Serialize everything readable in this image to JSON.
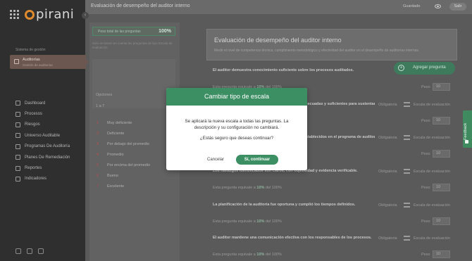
{
  "app": {
    "logo_text": "pirani"
  },
  "header": {
    "title": "Evaluación de desempeño del auditor interno",
    "status": "Guardado",
    "exit_label": "Salir"
  },
  "sidebar": {
    "caption": "Sistema de gestión",
    "active_item": {
      "label": "Auditorías",
      "sublabel": "Gestión de auditorías"
    },
    "items": [
      {
        "label": "Dashboard",
        "icon": "monitor-icon"
      },
      {
        "label": "Procesos",
        "icon": "list-icon"
      },
      {
        "label": "Riesgos",
        "icon": "alert-icon"
      },
      {
        "label": "Universo Auditable",
        "icon": "grid-icon"
      },
      {
        "label": "Programas De Auditoría",
        "icon": "folder-icon"
      },
      {
        "label": "Planes De Remediación",
        "icon": "check-icon"
      },
      {
        "label": "Reportes",
        "icon": "doc-icon"
      },
      {
        "label": "Indicadores",
        "icon": "target-icon"
      }
    ]
  },
  "left_panel": {
    "total_label": "Peso total de las preguntas",
    "total_value": "100%",
    "note": "Solo se tienen en cuenta las preguntas de tipo Escala de evaluación",
    "options_label": "Opciones",
    "range": "1 a 7",
    "scale": [
      {
        "num": "1",
        "label": "Muy deficiente"
      },
      {
        "num": "2",
        "label": "Deficiente"
      },
      {
        "num": "3",
        "label": "Por debajo del promedio"
      },
      {
        "num": "4",
        "label": "Promedio"
      },
      {
        "num": "5",
        "label": "Por encima del promedio"
      },
      {
        "num": "6",
        "label": "Bueno"
      },
      {
        "num": "7",
        "label": "Excelente"
      }
    ]
  },
  "main": {
    "title": "Evaluación de desempeño del auditor interno",
    "description": "Medir el nivel de competencia técnica, cumplimiento metodológico y efectividad del auditor en el desempeño de auditorías internas.",
    "add_button": "Agregar pregunta",
    "required_label": "Obligatoria",
    "scale_label": "Escala de evaluación",
    "weight_label": "Peso",
    "equiv_prefix": "Esta pregunta equivale a",
    "equiv_mid": "del",
    "equiv_total": "100%",
    "questions": [
      {
        "text": "El auditor demuestra conocimiento suficiente sobre los procesos auditados.",
        "equiv": "10%",
        "weight": "10"
      },
      {
        "text": "Las evidencias recopiladas por el auditor fueron adecuadas y suficientes para sustentar los hallazgos.",
        "equiv": "10%",
        "weight": "10"
      },
      {
        "text": "El auditor aplica los procedimientos de auditoría establecidos en el programa de auditoría.",
        "equiv": "10%",
        "weight": "10"
      },
      {
        "text": "Los hallazgos identificados son claros, con objetividad y evidencia verificable.",
        "equiv": "10%",
        "weight": "10"
      },
      {
        "text": "La planificación de la auditoría fue oportuna y cumplió los tiempos definidos.",
        "equiv": "10%",
        "weight": "10"
      },
      {
        "text": "El auditor mantiene una comunicación efectiva con los responsables de los procesos.",
        "equiv": "10%",
        "weight": "10"
      }
    ]
  },
  "feedback": {
    "label": "Feedback"
  },
  "modal": {
    "title": "Cambiar tipo de escala",
    "line1": "Se aplicará la nueva escala a todas las preguntas. La descripción y su configuración no cambiará.",
    "question": "¿Estás seguro que deseas continuar?",
    "cancel": "Cancelar",
    "confirm": "Sí, continuar"
  }
}
